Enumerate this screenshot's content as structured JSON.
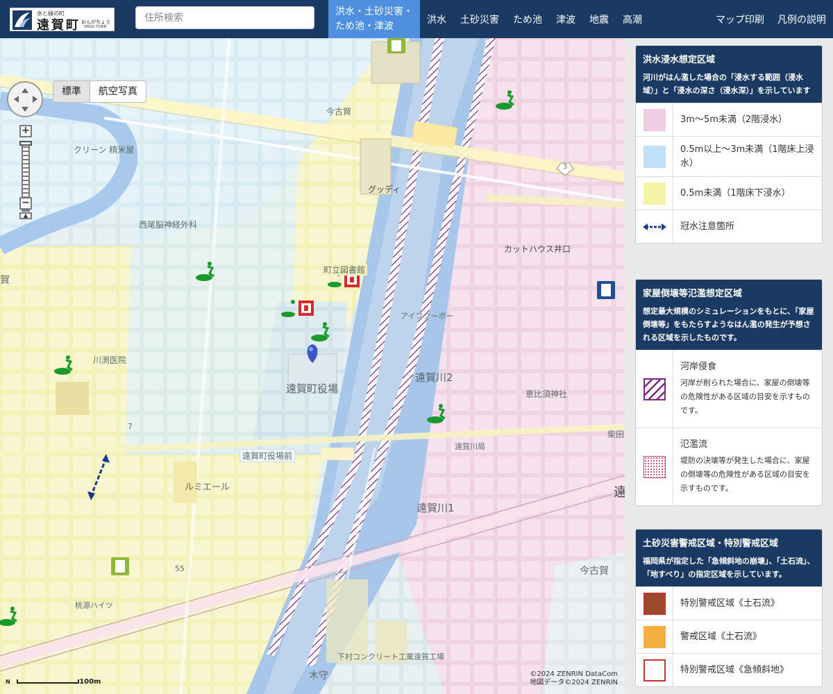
{
  "header": {
    "logo_top": "水と緑の町",
    "logo_name": "遠賀町",
    "logo_ruby": "おんがちょう",
    "logo_en": "ONGA TOWN",
    "search_placeholder": "住所検索",
    "tabs": [
      {
        "label": "洪水・土砂災害・ため池・津波",
        "active": true
      },
      {
        "label": "洪水",
        "active": false
      },
      {
        "label": "土砂災害",
        "active": false
      },
      {
        "label": "ため池",
        "active": false
      },
      {
        "label": "津波",
        "active": false
      },
      {
        "label": "地震",
        "active": false
      },
      {
        "label": "高潮",
        "active": false
      }
    ],
    "print_label": "マップ印刷",
    "legend_help_label": "凡例の説明"
  },
  "map": {
    "basemap_options": [
      "標準",
      "航空写真"
    ],
    "selected_basemap": "標準",
    "labels": {
      "imakoga_station": "今古賀",
      "cleaning": "クリーン 精米屋",
      "goody": "グッディ",
      "clinic_nishio": "西尾脳神経外科",
      "library": "町立図書館",
      "cut_house": "カットハウス井口",
      "kawabuchi": "川渕医院",
      "town_hall": "遠賀町役場",
      "ongakawa2": "遠賀川2",
      "ebisu": "恵比須神社",
      "ongakawa_post": "遠賀川局",
      "town_hall_mae": "遠賀町役場前",
      "lumiere": "ルミエール",
      "ongakawa1": "遠賀川1",
      "imakoga_area": "今古賀",
      "shimomura": "下村コンクリート工業遠賀工場",
      "kiseto": "桃源ハイツ",
      "kimori": "木守",
      "shibata": "柴田",
      "aifukubo": "アイフクーボー",
      "route": "3",
      "route55": "55",
      "edge_ka": "賀",
      "edge_on": "遠",
      "kyoto7": "7"
    },
    "scale_label": "100m",
    "north_label": "N",
    "copyright1": "©2024 ZENRIN DataCom",
    "copyright2": "地図データ©2024 ZENRIN"
  },
  "legend": {
    "flood": {
      "title": "洪水浸水想定区域",
      "desc": "河川がはん濫した場合の「浸水する範囲（浸水域）」と「浸水の深さ（浸水深）」を示しています",
      "items": [
        {
          "label": "3m～5m未満（2階浸水）",
          "color": "#f0cde3"
        },
        {
          "label": "0.5m以上～3m未満（1階床上浸水）",
          "color": "#bfe0f7"
        },
        {
          "label": "0.5m未満（1階床下浸水）",
          "color": "#f5f3a6"
        },
        {
          "label": "冠水注意箇所",
          "color": "#1b3a8a"
        }
      ]
    },
    "house": {
      "title": "家屋倒壊等氾濫想定区域",
      "desc": "想定最大規模のシミュレーションをもとに、「家屋倒壊等」をもたらすようなはん濫の発生が予想される区域を示したものです。",
      "items": [
        {
          "label": "河岸侵食",
          "sub": "河岸が削られた場合に、家屋の倒壊等の危険性がある区域の目安を示すものです。",
          "color": "#7b2a7d"
        },
        {
          "label": "氾濫流",
          "sub": "堤防の決壊等が発生した場合に、家屋の倒壊等の危険性がある区域の目安を示すものです。",
          "color": "#d0407a"
        }
      ]
    },
    "sediment": {
      "title": "土砂災害警戒区域・特別警戒区域",
      "desc": "福岡県が指定した「急傾斜地の崩壊」、「土石流」、「地すべり」の指定区域を示しています。",
      "items": [
        {
          "label": "特別警戒区域《土石流》",
          "color": "#9b4a2c"
        },
        {
          "label": "警戒区域《土石流》",
          "color": "#f2b040"
        },
        {
          "label": "特別警戒区域《急傾斜地》",
          "color": "#c2342e"
        }
      ]
    }
  }
}
